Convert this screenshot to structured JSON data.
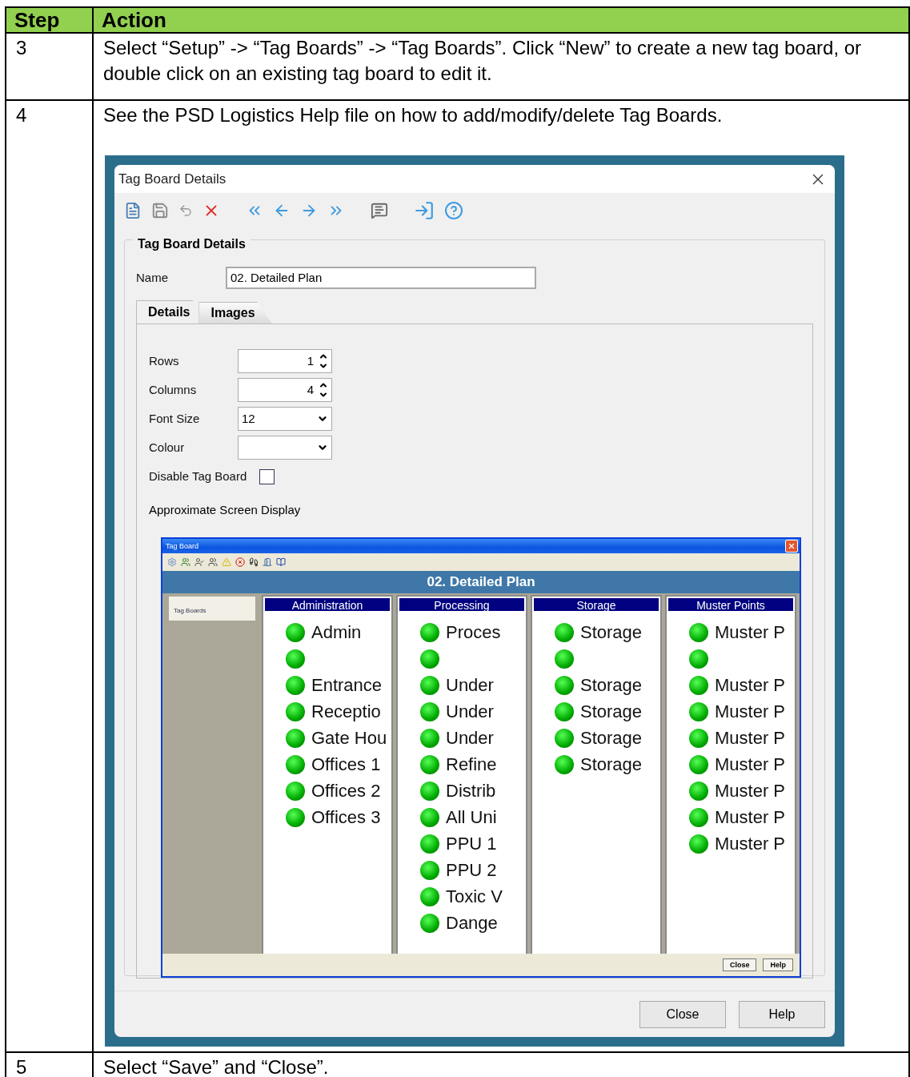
{
  "table": {
    "columns": [
      "Step",
      "Action"
    ],
    "rows": [
      {
        "step": "3",
        "action": "Select “Setup” -> “Tag Boards” -> “Tag Boards”. Click “New” to create a new tag board, or double click on an existing tag board to edit it."
      },
      {
        "step": "4",
        "action": "See the PSD Logistics Help file on how to add/modify/delete Tag Boards.",
        "screenshot": {
          "title": "Tag Board Details",
          "group_title": "Tag Board Details",
          "name_label": "Name",
          "name_value": "02. Detailed Plan",
          "tabs": [
            {
              "label": "Details",
              "selected": true
            },
            {
              "label": "Images",
              "selected": false
            }
          ],
          "fields": [
            {
              "kind": "spin",
              "label": "Rows",
              "value": "1"
            },
            {
              "kind": "spin",
              "label": "Columns",
              "value": "4"
            },
            {
              "kind": "dropdown",
              "label": "Font Size",
              "value": "12"
            },
            {
              "kind": "dropdown",
              "label": "Colour"
            },
            {
              "kind": "checkbox",
              "label": "Disable Tag Board",
              "checked": false
            }
          ],
          "preview_label": "Approximate Screen Display",
          "preview": {
            "title": "Tag Board",
            "board_title": "02. Detailed Plan",
            "sidebar_tab": "Tag Boards",
            "columns": [
              {
                "title": "Administration",
                "items": [
                  {
                    "kind": "tag",
                    "label": "Admin"
                  },
                  {
                    "kind": "blank"
                  },
                  {
                    "kind": "tag",
                    "label": "Entrance"
                  },
                  {
                    "kind": "tag",
                    "label": "Receptio"
                  },
                  {
                    "kind": "tag",
                    "label": "Gate Hou"
                  },
                  {
                    "kind": "tag",
                    "label": "Offices 1"
                  },
                  {
                    "kind": "tag",
                    "label": "Offices 2"
                  },
                  {
                    "kind": "tag",
                    "label": "Offices 3"
                  }
                ]
              },
              {
                "title": "Processing",
                "items": [
                  {
                    "kind": "tag",
                    "label": "Proces"
                  },
                  {
                    "kind": "blank"
                  },
                  {
                    "kind": "tag",
                    "label": "Under"
                  },
                  {
                    "kind": "tag",
                    "label": "Under"
                  },
                  {
                    "kind": "tag",
                    "label": "Under"
                  },
                  {
                    "kind": "tag",
                    "label": "Refine"
                  },
                  {
                    "kind": "tag",
                    "label": "Distrib"
                  },
                  {
                    "kind": "tag",
                    "label": "All Uni"
                  },
                  {
                    "kind": "tag",
                    "label": "PPU 1"
                  },
                  {
                    "kind": "tag",
                    "label": "PPU 2"
                  },
                  {
                    "kind": "tag",
                    "label": "Toxic V"
                  },
                  {
                    "kind": "tag",
                    "label": "Dange"
                  }
                ]
              },
              {
                "title": "Storage",
                "items": [
                  {
                    "kind": "tag",
                    "label": "Storage"
                  },
                  {
                    "kind": "blank"
                  },
                  {
                    "kind": "tag",
                    "label": "Storage"
                  },
                  {
                    "kind": "tag",
                    "label": "Storage"
                  },
                  {
                    "kind": "tag",
                    "label": "Storage"
                  },
                  {
                    "kind": "tag",
                    "label": "Storage"
                  }
                ]
              },
              {
                "title": "Muster Points",
                "items": [
                  {
                    "kind": "tag",
                    "label": "Muster P"
                  },
                  {
                    "kind": "blank"
                  },
                  {
                    "kind": "tag",
                    "label": "Muster P"
                  },
                  {
                    "kind": "tag",
                    "label": "Muster P"
                  },
                  {
                    "kind": "tag",
                    "label": "Muster P"
                  },
                  {
                    "kind": "tag",
                    "label": "Muster P"
                  },
                  {
                    "kind": "tag",
                    "label": "Muster P"
                  },
                  {
                    "kind": "tag",
                    "label": "Muster P"
                  },
                  {
                    "kind": "tag",
                    "label": "Muster P"
                  }
                ]
              }
            ],
            "buttons": [
              "Close",
              "Help"
            ]
          },
          "buttons": [
            "Close",
            "Help"
          ]
        }
      },
      {
        "step": "5",
        "action": "Select “Save” and “Close”."
      }
    ]
  }
}
